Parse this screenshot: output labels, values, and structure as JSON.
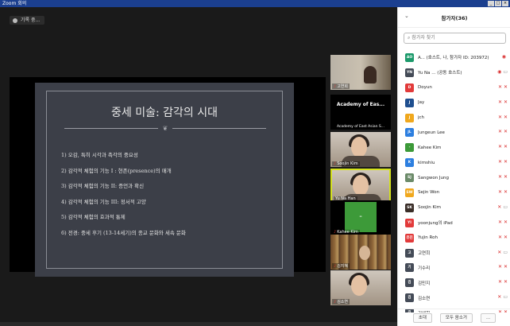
{
  "window": {
    "title": "Zoom 회의",
    "controls": [
      "_",
      "□",
      "×"
    ]
  },
  "recording": {
    "label": "기록 중..."
  },
  "slide": {
    "title": "중세 미술: 감각의 시대",
    "ornament": "❦",
    "items": [
      "1) 오감, 특히 시각과 촉각의 중요성",
      "2) 감각적 체험의 기능 I : 현존(presence)의 매개",
      "3) 감각적 체험의 기능 II: 증언과 확신",
      "4) 감각적 체험의 기능 III: 정서적 고양",
      "5) 감각적 체험의 효과적 통제",
      "6) 전경: 중세 후기 (13-14세기)의 종교 문화와 세속 문화"
    ]
  },
  "thumbnails": [
    {
      "id": "t1",
      "label": "고연희",
      "muted": true
    },
    {
      "id": "t2",
      "title": "Academy of Eas...",
      "label": "Academy of East Asian S...",
      "muted": false
    },
    {
      "id": "t3",
      "label": "Soojin Kim",
      "muted": true
    },
    {
      "id": "t4",
      "label": "Yu Na Han",
      "muted": false
    },
    {
      "id": "t5",
      "label": "Kahee Kim",
      "avatar": "-",
      "muted": true
    },
    {
      "id": "t6",
      "label": "김지혜",
      "muted": true
    },
    {
      "id": "t7",
      "label": "김소연",
      "muted": true
    }
  ],
  "participants_panel": {
    "title": "참가자(36)",
    "search_placeholder": "참가자 찾기",
    "participants": [
      {
        "initials": "AO",
        "color": "#1c9a6b",
        "name": "A... (호스트, 나, 참가자 ID: 203972)",
        "mic": "◉",
        "cam": ""
      },
      {
        "initials": "YN",
        "color": "#444b57",
        "name": "Yu Na ... (공동 호스트)",
        "mic": "◉",
        "cam": "▭"
      },
      {
        "initials": "D",
        "color": "#e23b3b",
        "name": "Doyun",
        "mic": "✕",
        "cam": "✕"
      },
      {
        "initials": "J",
        "color": "#1f4f8f",
        "name": "Jay",
        "mic": "✕",
        "cam": "✕"
      },
      {
        "initials": "J",
        "color": "#f0a81e",
        "name": "jch",
        "mic": "✕",
        "cam": "✕"
      },
      {
        "initials": "JL",
        "color": "#2d7fe0",
        "name": "Jungeun Lee",
        "mic": "✕",
        "cam": "✕"
      },
      {
        "initials": "-",
        "color": "#3d9a39",
        "name": "Kahee Kim",
        "mic": "✕",
        "cam": "✕"
      },
      {
        "initials": "K",
        "color": "#2d7fe0",
        "name": "kimshiu",
        "mic": "✕",
        "cam": "✕"
      },
      {
        "initials": "SJ",
        "color": "#6c8b6a",
        "name": "Sangwon Jung",
        "mic": "✕",
        "cam": "✕"
      },
      {
        "initials": "SW",
        "color": "#f0a81e",
        "name": "Sejin Won",
        "mic": "✕",
        "cam": "✕"
      },
      {
        "initials": "SK",
        "color": "#3a2e28",
        "name": "Soojin Kim",
        "mic": "✕",
        "cam": "▭"
      },
      {
        "initials": "YI",
        "color": "#e23b3b",
        "name": "yoonjung의 iPad",
        "mic": "✕",
        "cam": "✕"
      },
      {
        "initials": "유진",
        "color": "#e23b3b",
        "name": "Yujin Roh",
        "mic": "✕",
        "cam": "✕"
      },
      {
        "initials": "고",
        "color": "#444b57",
        "name": "고연희",
        "mic": "✕",
        "cam": "▭"
      },
      {
        "initials": "기",
        "color": "#444b57",
        "name": "기수리",
        "mic": "✕",
        "cam": "✕"
      },
      {
        "initials": "김",
        "color": "#444b57",
        "name": "김민지",
        "mic": "✕",
        "cam": "✕"
      },
      {
        "initials": "김",
        "color": "#444b57",
        "name": "김소연",
        "mic": "✕",
        "cam": "▭"
      },
      {
        "initials": "김",
        "color": "#444b57",
        "name": "김애희",
        "mic": "✕",
        "cam": "✕"
      }
    ],
    "footer": {
      "invite": "초대",
      "mute_all": "모두 음소거",
      "more": "..."
    }
  }
}
